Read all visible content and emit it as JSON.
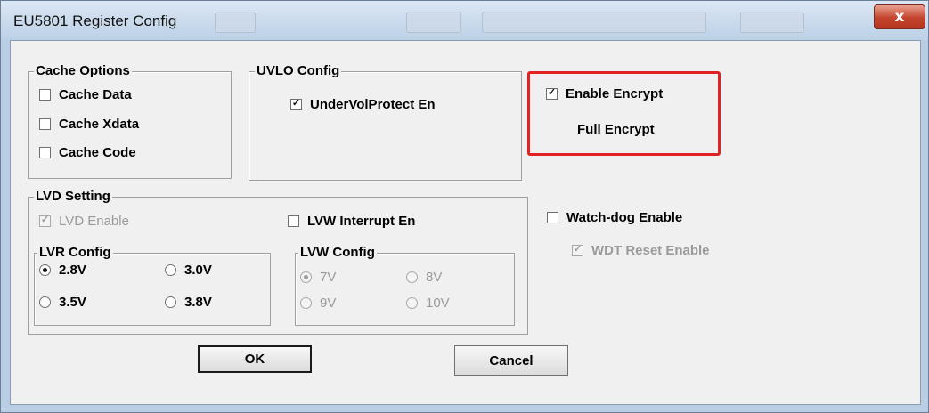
{
  "window": {
    "title": "EU5801 Register Config",
    "close_symbol": "x"
  },
  "cache_options": {
    "legend": "Cache Options",
    "items": [
      {
        "label": "Cache Data",
        "checked": false
      },
      {
        "label": "Cache Xdata",
        "checked": false
      },
      {
        "label": "Cache Code",
        "checked": false
      }
    ]
  },
  "uvlo_config": {
    "legend": "UVLO Config",
    "item": {
      "label": "UnderVolProtect En",
      "checked": true
    }
  },
  "encrypt": {
    "enable_label": "Enable Encrypt",
    "enable_checked": true,
    "mode_text": "Full Encrypt",
    "highlight_color": "#e02222"
  },
  "lvd_setting": {
    "legend": "LVD Setting",
    "lvd_enable": {
      "label": "LVD Enable",
      "checked": true,
      "disabled": true
    },
    "lvw_interrupt": {
      "label": "LVW Interrupt En",
      "checked": false
    },
    "lvr_config": {
      "legend": "LVR Config",
      "options": [
        {
          "label": "2.8V",
          "selected": true
        },
        {
          "label": "3.0V",
          "selected": false
        },
        {
          "label": "3.5V",
          "selected": false
        },
        {
          "label": "3.8V",
          "selected": false
        }
      ]
    },
    "lvw_config": {
      "legend": "LVW Config",
      "disabled": true,
      "options": [
        {
          "label": "7V",
          "selected": true
        },
        {
          "label": "8V",
          "selected": false
        },
        {
          "label": "9V",
          "selected": false
        },
        {
          "label": "10V",
          "selected": false
        }
      ]
    }
  },
  "watchdog": {
    "enable": {
      "label": "Watch-dog Enable",
      "checked": false
    },
    "reset": {
      "label": "WDT Reset Enable",
      "checked": true,
      "disabled": true
    }
  },
  "buttons": {
    "ok": "OK",
    "cancel": "Cancel"
  }
}
